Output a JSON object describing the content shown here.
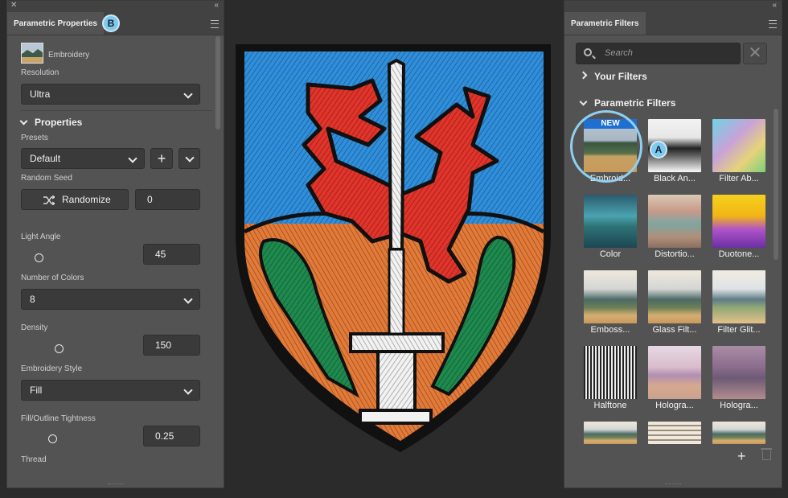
{
  "left_panel": {
    "tab_title": "Parametric Properties",
    "callout": "B",
    "layer_name": "Embroidery",
    "resolution": {
      "label": "Resolution",
      "value": "Ultra"
    },
    "properties_section": "Properties",
    "presets": {
      "label": "Presets",
      "value": "Default",
      "add": "+"
    },
    "random_seed": {
      "label": "Random Seed",
      "button": "Randomize",
      "value": "0"
    },
    "light_angle": {
      "label": "Light Angle",
      "value": "45",
      "level": 0.15
    },
    "number_of_colors": {
      "label": "Number of Colors",
      "value": "8"
    },
    "density": {
      "label": "Density",
      "value": "150",
      "level": 0.3
    },
    "embroidery_style": {
      "label": "Embroidery Style",
      "value": "Fill"
    },
    "tightness": {
      "label": "Fill/Outline Tightness",
      "value": "0.25",
      "level": 0.25
    },
    "thread": {
      "label": "Thread"
    }
  },
  "right_panel": {
    "tab_title": "Parametric Filters",
    "search_placeholder": "Search",
    "your_filters": "Your Filters",
    "parametric_filters": "Parametric Filters",
    "callout": "A",
    "new_badge": "NEW",
    "tiles": [
      {
        "name": "Embroid...",
        "style": "emb"
      },
      {
        "name": "Black An...",
        "style": "bw"
      },
      {
        "name": "Filter Ab...",
        "style": "ab"
      },
      {
        "name": "Color",
        "style": "color"
      },
      {
        "name": "Distortio...",
        "style": "dist"
      },
      {
        "name": "Duotone...",
        "style": "duo"
      },
      {
        "name": "Emboss...",
        "style": "land"
      },
      {
        "name": "Glass Filt...",
        "style": "land"
      },
      {
        "name": "Filter Glit...",
        "style": "glit"
      },
      {
        "name": "Halftone",
        "style": "half"
      },
      {
        "name": "Hologra...",
        "style": "holo1"
      },
      {
        "name": "Hologra...",
        "style": "holo2"
      },
      {
        "name": "",
        "style": "land"
      },
      {
        "name": "",
        "style": "stripe"
      },
      {
        "name": "",
        "style": "land"
      }
    ],
    "add_button": "+"
  },
  "canvas": {
    "image": "embroidered-shield-patch"
  }
}
